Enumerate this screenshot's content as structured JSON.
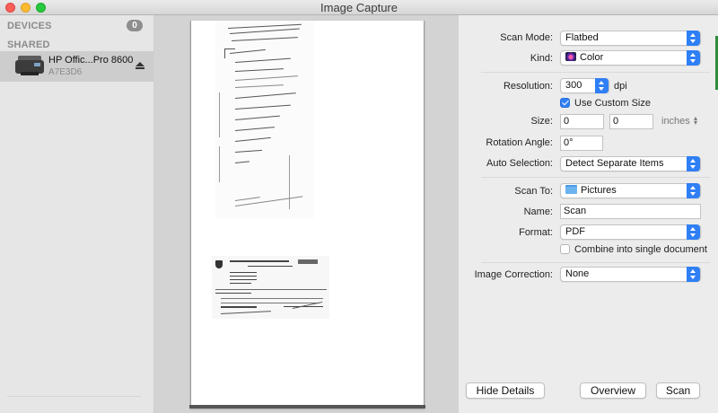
{
  "window": {
    "title": "Image Capture"
  },
  "sidebar": {
    "devices_header": "DEVICES",
    "devices_count": "0",
    "shared_header": "SHARED",
    "shared_items": [
      {
        "name": "HP Offic...Pro 8600",
        "id": "A7E3D6"
      }
    ]
  },
  "panel": {
    "scan_mode": {
      "label": "Scan Mode:",
      "value": "Flatbed"
    },
    "kind": {
      "label": "Kind:",
      "value": "Color"
    },
    "resolution": {
      "label": "Resolution:",
      "value": "300",
      "unit": "dpi"
    },
    "custom_size": {
      "label": "Use Custom Size",
      "checked": true
    },
    "size": {
      "label": "Size:",
      "width": "0",
      "height": "0",
      "unit": "inches"
    },
    "rotation": {
      "label": "Rotation Angle:",
      "value": "0°"
    },
    "auto_selection": {
      "label": "Auto Selection:",
      "value": "Detect Separate Items"
    },
    "scan_to": {
      "label": "Scan To:",
      "value": "Pictures"
    },
    "name": {
      "label": "Name:",
      "value": "Scan"
    },
    "format": {
      "label": "Format:",
      "value": "PDF"
    },
    "combine": {
      "label": "Combine into single document",
      "checked": false
    },
    "image_correction": {
      "label": "Image Correction:",
      "value": "None"
    }
  },
  "buttons": {
    "hide_details": "Hide Details",
    "overview": "Overview",
    "scan": "Scan"
  },
  "colors": {
    "accent": "#2f7ff5",
    "close": "#fc5f57",
    "minimize": "#fdbc2e",
    "maximize": "#28c840"
  }
}
